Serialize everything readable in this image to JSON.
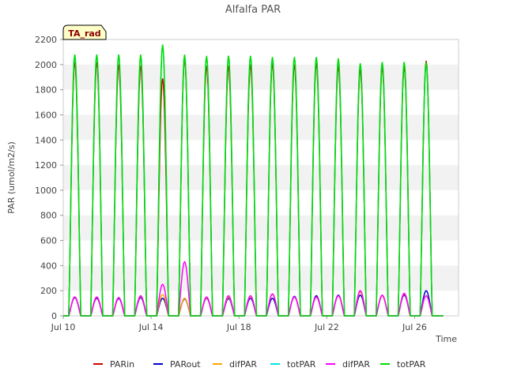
{
  "chart_data": {
    "type": "line",
    "title": "Alfalfa PAR",
    "xlabel": "Time",
    "ylabel": "PAR (umol/m2/s)",
    "badge": "TA_rad",
    "ylim": [
      0,
      2200
    ],
    "yticks": [
      0,
      200,
      400,
      600,
      800,
      1000,
      1200,
      1400,
      1600,
      1800,
      2000,
      2200
    ],
    "xlim": [
      "Jul 10",
      "Jul 28"
    ],
    "xticks": [
      "Jul 10",
      "Jul 14",
      "Jul 18",
      "Jul 22",
      "Jul 26"
    ],
    "grid": "horizontal bands",
    "legend": "bottom",
    "day_starts": [
      "Jul 10",
      "Jul 11",
      "Jul 12",
      "Jul 13",
      "Jul 14",
      "Jul 15",
      "Jul 16",
      "Jul 17",
      "Jul 18",
      "Jul 19",
      "Jul 20",
      "Jul 21",
      "Jul 22",
      "Jul 23",
      "Jul 24",
      "Jul 25",
      "Jul 26",
      "Jul 27"
    ],
    "series": [
      {
        "name": "PARin",
        "color": "#cc0000",
        "daily_peak": [
          2020,
          2020,
          2000,
          1990,
          1890,
          2040,
          1990,
          1990,
          2000,
          2010,
          2000,
          2010,
          1990,
          1960,
          1980,
          1980,
          2030
        ]
      },
      {
        "name": "PARout",
        "color": "#0000cc",
        "daily_peak": [
          145,
          140,
          138,
          145,
          140,
          135,
          140,
          138,
          140,
          140,
          155,
          160,
          165,
          165,
          160,
          165,
          200
        ]
      },
      {
        "name": "difPAR",
        "color": "#ffa500",
        "daily_peak": [
          150,
          148,
          145,
          155,
          170,
          140,
          145,
          150,
          155,
          170,
          150,
          150,
          160,
          190,
          160,
          175,
          160
        ]
      },
      {
        "name": "totPAR",
        "color": "#00e5e5",
        "daily_peak": [
          2080,
          2080,
          2080,
          2070,
          2150,
          2070,
          2060,
          2070,
          2070,
          2060,
          2060,
          2060,
          2040,
          2010,
          2020,
          2020,
          2000
        ]
      },
      {
        "name": "difPAR",
        "color": "#ff00ff",
        "daily_peak": [
          150,
          150,
          145,
          160,
          250,
          430,
          150,
          160,
          160,
          175,
          150,
          150,
          160,
          200,
          165,
          180,
          160
        ]
      },
      {
        "name": "totPAR",
        "color": "#00dd00",
        "daily_peak": [
          2080,
          2080,
          2080,
          2080,
          2160,
          2080,
          2070,
          2070,
          2070,
          2060,
          2060,
          2060,
          2050,
          2010,
          2020,
          2020,
          2020
        ]
      }
    ]
  }
}
